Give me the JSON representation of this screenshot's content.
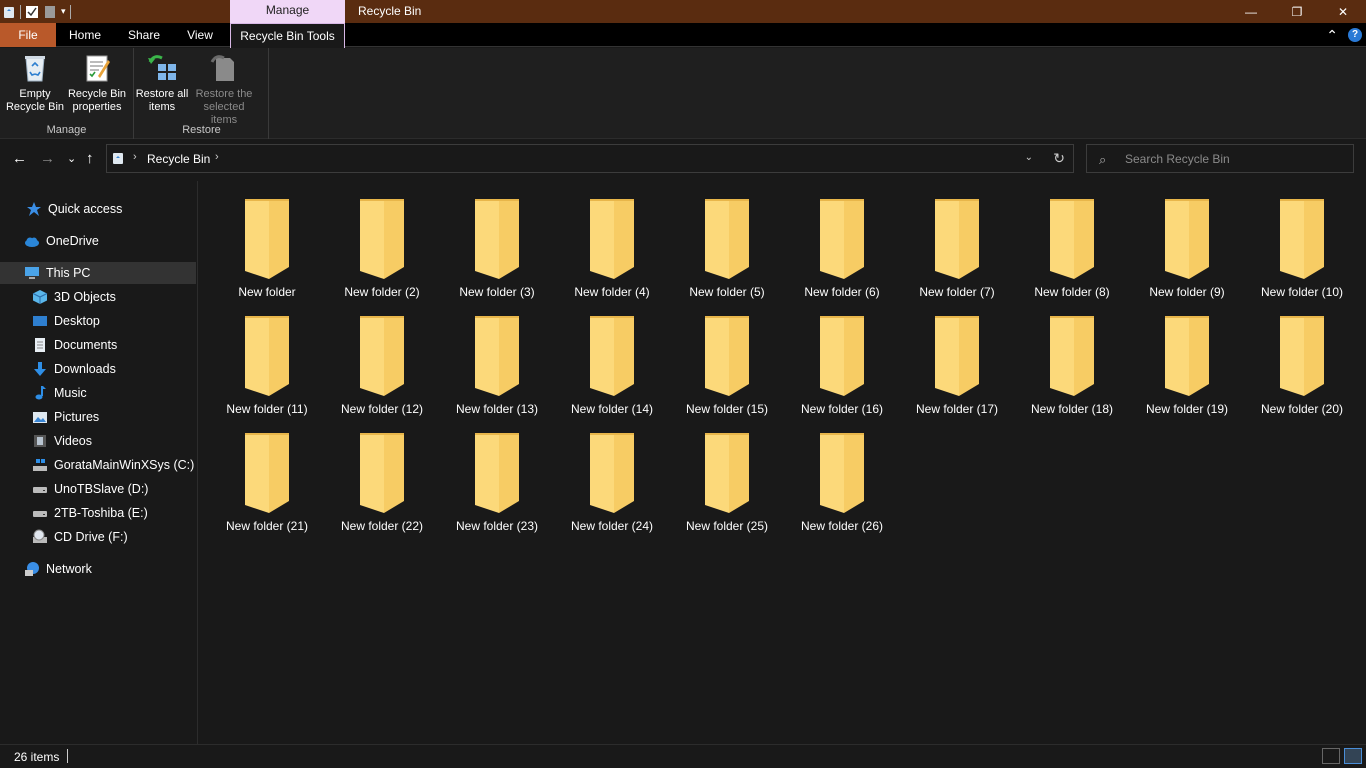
{
  "titlebar": {
    "context_header": "Manage",
    "title": "Recycle Bin",
    "minimize_glyph": "—",
    "maximize_glyph": "❐",
    "close_glyph": "✕"
  },
  "tabs": {
    "file": "File",
    "home": "Home",
    "share": "Share",
    "view": "View",
    "tools": "Recycle Bin Tools",
    "collapse_glyph": "⌃",
    "help_glyph": "?"
  },
  "ribbon": {
    "empty": "Empty Recycle Bin",
    "properties": "Recycle Bin properties",
    "manage_label": "Manage",
    "restore_all": "Restore all items",
    "restore_selected": "Restore the selected items",
    "restore_label": "Restore"
  },
  "address": {
    "back": "←",
    "forward": "→",
    "recent": "⌄",
    "up": "↑",
    "sep": "›",
    "crumb": "Recycle Bin",
    "dropdown": "⌄",
    "refresh": "↻"
  },
  "search": {
    "icon": "⌕",
    "placeholder": "Search Recycle Bin"
  },
  "nav": {
    "quick_access": "Quick access",
    "onedrive": "OneDrive",
    "this_pc": "This PC",
    "objects3d": "3D Objects",
    "desktop": "Desktop",
    "documents": "Documents",
    "downloads": "Downloads",
    "music": "Music",
    "pictures": "Pictures",
    "videos": "Videos",
    "drive_c": "GorataMainWinXSys (C:)",
    "drive_d": "UnoTBSlave (D:)",
    "drive_e": "2TB-Toshiba (E:)",
    "drive_f": "CD Drive (F:)",
    "network": "Network"
  },
  "folders": [
    "New folder",
    "New folder (2)",
    "New folder (3)",
    "New folder (4)",
    "New folder (5)",
    "New folder (6)",
    "New folder (7)",
    "New folder (8)",
    "New folder (9)",
    "New folder (10)",
    "New folder (11)",
    "New folder (12)",
    "New folder (13)",
    "New folder (14)",
    "New folder (15)",
    "New folder (16)",
    "New folder (17)",
    "New folder (18)",
    "New folder (19)",
    "New folder (20)",
    "New folder (21)",
    "New folder (22)",
    "New folder (23)",
    "New folder (24)",
    "New folder (25)",
    "New folder (26)"
  ],
  "status": {
    "count": "26 items"
  },
  "colors": {
    "title_bg": "#5a2c10",
    "file_tab": "#b9592a",
    "context_tab": "#f0d7f7",
    "folder_back": "#e8b64a",
    "folder_front": "#fcd97a",
    "background": "#191919"
  }
}
